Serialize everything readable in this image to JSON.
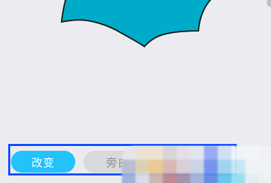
{
  "toolbar": {
    "primary_label": "改变",
    "secondary_label": "旁白"
  },
  "colors": {
    "shape_fill": "#00abc9",
    "shape_stroke": "#1a1a1a",
    "primary_pill": "#23c2fb",
    "secondary_pill": "#d9d9dc",
    "highlight_border": "#0a4cff",
    "background": "#ececf0"
  },
  "mosaic": [
    "#e7e7ea",
    "#e9e3d4",
    "#eee3cf",
    "#d7d4d9",
    "#e2e0e6",
    "#e0e5ee",
    "#93a8f7",
    "#cfdef7",
    "#eef5fb",
    "#f3f6f9",
    "#f2f3f5",
    "#b7bed2",
    "#ddd1ad",
    "#e8c98d",
    "#d5b7b2",
    "#d9cfd6",
    "#cbd2e4",
    "#7390ee",
    "#9fd3ef",
    "#c6e6f6",
    "#eef3f7",
    "#f1f2f4",
    "#9fb1d8",
    "#d9dbe8",
    "#ccb3ae",
    "#bc868d",
    "#a58fa8",
    "#9fb4d8",
    "#5f89e6",
    "#64c4ec",
    "#96def0",
    "#e2eef6",
    "#eff1f3"
  ]
}
